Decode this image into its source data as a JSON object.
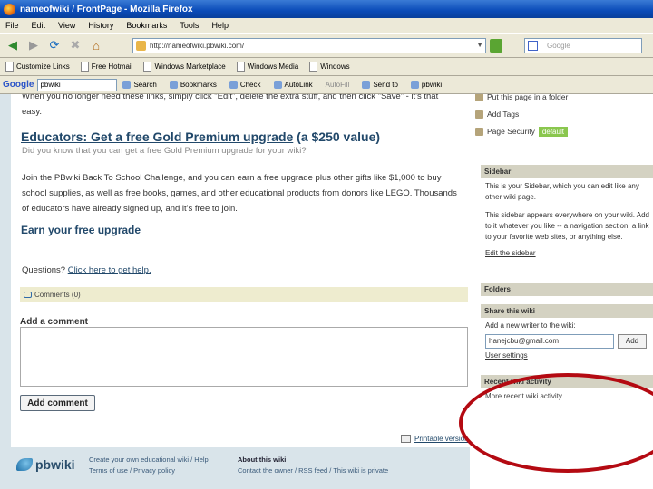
{
  "window": {
    "title": "nameofwiki / FrontPage - Mozilla Firefox"
  },
  "menu": [
    "File",
    "Edit",
    "View",
    "History",
    "Bookmarks",
    "Tools",
    "Help"
  ],
  "nav": {
    "url": "http://nameofwiki.pbwiki.com/",
    "search_placeholder": "Google"
  },
  "bookmarks": [
    "Customize Links",
    "Free Hotmail",
    "Windows Marketplace",
    "Windows Media",
    "Windows"
  ],
  "google_toolbar": {
    "logo": "Google",
    "input_value": "pbwiki",
    "items": [
      "Search",
      "Bookmarks",
      "Check",
      "AutoLink",
      "AutoFill",
      "Send to",
      "pbwiki"
    ]
  },
  "main": {
    "intro_text": "When you no longer need these links, simply click \"Edit\", delete the extra stuff, and then click \"Save\" - it's that easy.",
    "educators_heading_link": "Educators: Get a free Gold Premium upgrade",
    "educators_heading_suffix": " (a $250 value)",
    "educators_q": "Did you know that you can get a free Gold Premium upgrade for your wiki?",
    "educators_body": "Join the PBwiki Back To School Challenge, and you can earn a free upgrade plus other gifts like $1,000 to buy school supplies, as well as free books, games, and other educational products from donors like LEGO. Thousands of educators have already signed up, and it's free to join.",
    "earn_link": "Earn your free upgrade",
    "questions_prefix": "Questions? ",
    "questions_link": "Click here to get help.",
    "comments_label": "Comments (0)",
    "add_comment_label": "Add a comment",
    "add_comment_button": "Add comment",
    "printable": "Printable version"
  },
  "footer": {
    "logo": "pbwiki",
    "col1_line1": "Create your own educational wiki / Help",
    "col1_line2": "Terms of use / Privacy policy",
    "col2_line1": "About this wiki",
    "col2_line2": "Contact the owner / RSS feed / This wiki is private"
  },
  "sidebar": {
    "actions": [
      "Put this page in a folder",
      "Add Tags",
      "Page Security"
    ],
    "security_badge": "default",
    "sidebar_box": {
      "title": "Sidebar",
      "text1": "This is your Sidebar, which you can edit like any other wiki page.",
      "text2": "This sidebar appears everywhere on your wiki. Add to it whatever you like -- a navigation section, a link to your favorite web sites, or anything else.",
      "edit_link": "Edit the sidebar"
    },
    "folders_title": "Folders",
    "share_box": {
      "title": "Share this wiki",
      "label": "Add a new writer to the wiki:",
      "input_value": "hanejcbu@gmail.com",
      "button": "Add",
      "user_settings": "User settings"
    },
    "activity_box": {
      "title": "Recent wiki activity",
      "link": "More recent wiki activity"
    }
  },
  "colors": {
    "heading": "#21486a",
    "highlight_ring": "#b40a12",
    "badge": "#8ac74e"
  }
}
